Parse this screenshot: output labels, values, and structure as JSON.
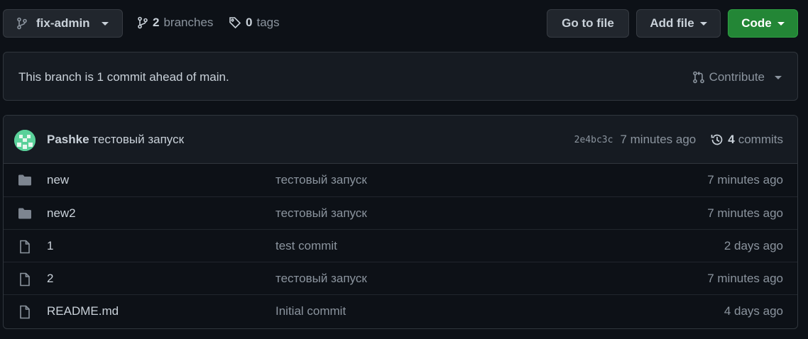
{
  "topbar": {
    "branch_name": "fix-admin",
    "branches_count": "2",
    "branches_label": "branches",
    "tags_count": "0",
    "tags_label": "tags",
    "goto_file_label": "Go to file",
    "add_file_label": "Add file",
    "code_label": "Code"
  },
  "ahead": {
    "message": "This branch is 1 commit ahead of main.",
    "contribute_label": "Contribute"
  },
  "latest_commit": {
    "author": "Pashke",
    "message": "тестовый запуск",
    "sha": "2e4bc3c",
    "age": "7 minutes ago",
    "commits_count": "4",
    "commits_label": "commits"
  },
  "files": [
    {
      "type": "folder-icon",
      "name": "new",
      "message": "тестовый запуск",
      "age": "7 minutes ago"
    },
    {
      "type": "folder-icon",
      "name": "new2",
      "message": "тестовый запуск",
      "age": "7 minutes ago"
    },
    {
      "type": "file-icon",
      "name": "1",
      "message": "test commit",
      "age": "2 days ago"
    },
    {
      "type": "file-icon",
      "name": "2",
      "message": "тестовый запуск",
      "age": "7 minutes ago"
    },
    {
      "type": "file-icon",
      "name": "README.md",
      "message": "Initial commit",
      "age": "4 days ago"
    }
  ],
  "colors": {
    "background": "#0d1117",
    "surface": "#161b22",
    "border": "#30363d",
    "primary_button": "#238636",
    "muted_text": "#8b949e"
  }
}
